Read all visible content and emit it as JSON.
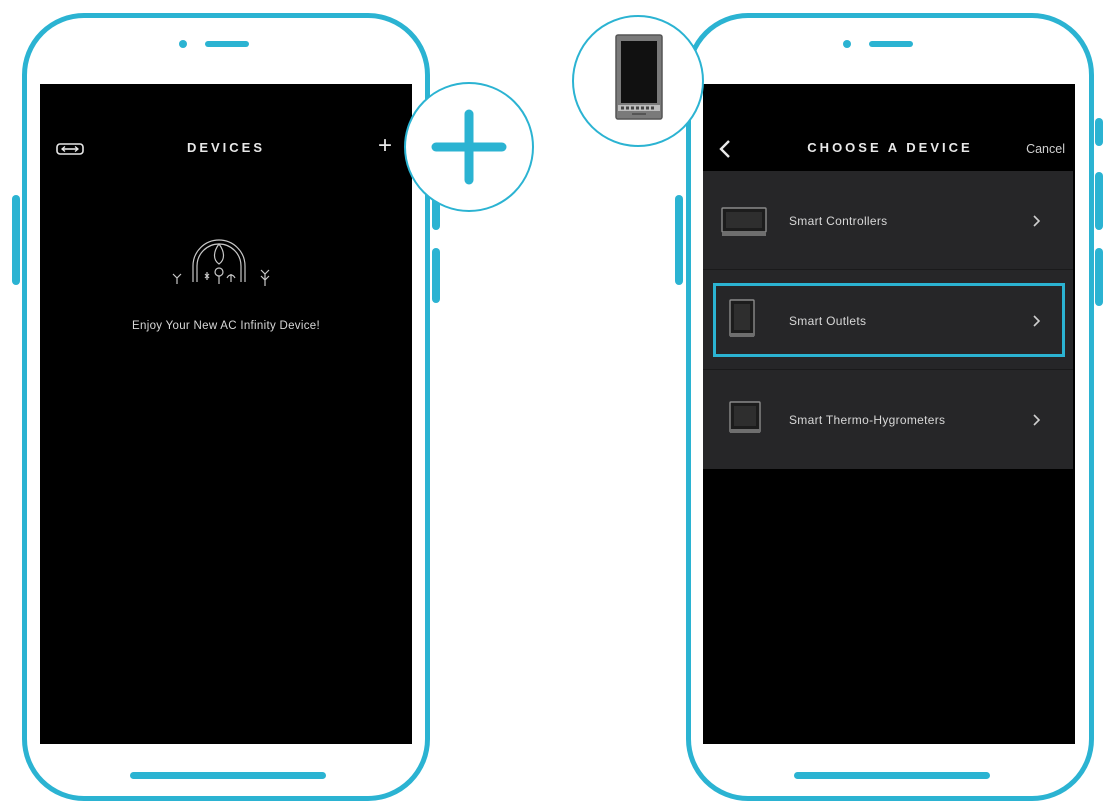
{
  "colors": {
    "accent": "#2bb3d2",
    "screen": "#000000",
    "list_bg": "#262628"
  },
  "left_screen": {
    "title": "DEVICES",
    "menu_icon": "device-toggle-icon",
    "add_icon": "plus-icon",
    "add_symbol": "+",
    "illustration": "ac-infinity-plants-illustration",
    "message": "Enjoy Your New AC Infinity Device!"
  },
  "right_screen": {
    "back_icon": "chevron-left-icon",
    "title": "CHOOSE A DEVICE",
    "cancel_label": "Cancel",
    "devices": [
      {
        "label": "Smart Controllers",
        "icon": "controller-icon",
        "highlighted": false
      },
      {
        "label": "Smart Outlets",
        "icon": "outlet-icon",
        "highlighted": true
      },
      {
        "label": "Smart Thermo-Hygrometers",
        "icon": "thermo-hygrometer-icon",
        "highlighted": false
      }
    ]
  },
  "callouts": {
    "add": "plus-icon",
    "device": "smart-outlet-device-icon"
  }
}
